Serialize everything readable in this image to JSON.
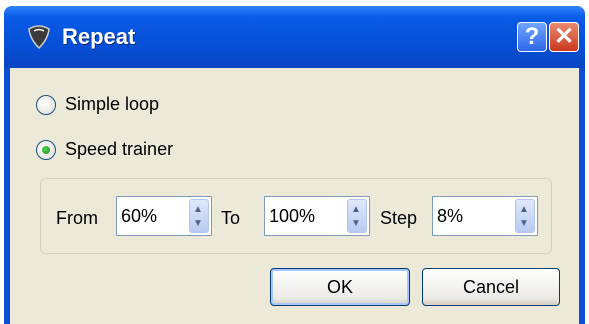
{
  "window": {
    "title": "Repeat",
    "help_label": "?",
    "close_label": "✕",
    "app_icon": "guitar-pick-icon"
  },
  "mode": {
    "options": [
      {
        "label": "Simple loop",
        "selected": false
      },
      {
        "label": "Speed trainer",
        "selected": true
      }
    ]
  },
  "speed": {
    "from_label": "From",
    "from_value": "60%",
    "to_label": "To",
    "to_value": "100%",
    "step_label": "Step",
    "step_value": "8%"
  },
  "buttons": {
    "ok": "OK",
    "cancel": "Cancel"
  }
}
